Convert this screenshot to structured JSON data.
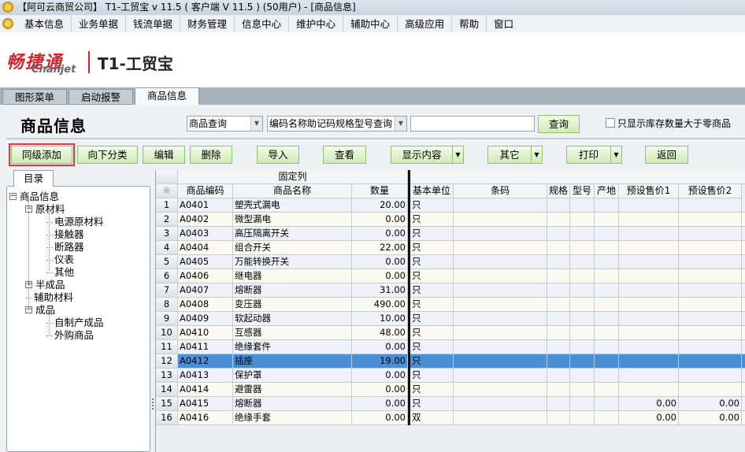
{
  "window": {
    "title": "【阿可云商贸公司】 T1-工贸宝 v 11.5 ( 客户端 V 11.5 ) (50用户) - [商品信息]"
  },
  "menu": [
    "基本信息",
    "业务单据",
    "钱流单据",
    "财务管理",
    "信息中心",
    "维护中心",
    "辅助中心",
    "高级应用",
    "帮助",
    "窗口"
  ],
  "logo": {
    "brand_cn": "畅捷通",
    "brand_en": "Chanjet",
    "product": "T1-工贸宝"
  },
  "tabs": [
    "图形菜单",
    "启动报警",
    "商品信息"
  ],
  "page": {
    "title": "商品信息"
  },
  "search": {
    "type": "商品查询",
    "mode": "编码名称助记码规格型号查询",
    "value": "",
    "query_label": "查询",
    "stock_checkbox_label": "只显示库存数量大于零商品",
    "stock_checked": false
  },
  "toolbar": {
    "same_level_add": "同级添加",
    "add_sub": "向下分类",
    "edit": "编辑",
    "delete": "删除",
    "import": "导入",
    "view": "查看",
    "display": "显示内容",
    "other": "其它",
    "print": "打印",
    "back": "返回"
  },
  "tree": {
    "tab": "目录",
    "nodes": [
      {
        "label": "商品信息",
        "level": 0,
        "toggle": "-"
      },
      {
        "label": "原材料",
        "level": 1,
        "toggle": "-"
      },
      {
        "label": "电源原材料",
        "level": 2
      },
      {
        "label": "接触器",
        "level": 2
      },
      {
        "label": "断路器",
        "level": 2
      },
      {
        "label": "仪表",
        "level": 2
      },
      {
        "label": "其他",
        "level": 2
      },
      {
        "label": "半成品",
        "level": 1,
        "toggle": "+"
      },
      {
        "label": "辅助材料",
        "level": 1
      },
      {
        "label": "成品",
        "level": 1,
        "toggle": "-"
      },
      {
        "label": "自制产成品",
        "level": 2
      },
      {
        "label": "外购商品",
        "level": 2
      }
    ]
  },
  "grid": {
    "fixed_group": "固定列",
    "corner": "※",
    "columns": [
      "商品编码",
      "商品名称",
      "数量",
      "基本单位",
      "条码",
      "规格",
      "型号",
      "产地",
      "预设售价1",
      "预设售价2"
    ],
    "selected_row": 12,
    "rows": [
      [
        "1",
        "A0401",
        "塑壳式漏电",
        "20.00",
        "只",
        "",
        "",
        "",
        "",
        "",
        ""
      ],
      [
        "2",
        "A0402",
        "微型漏电",
        "0.00",
        "只",
        "",
        "",
        "",
        "",
        "",
        ""
      ],
      [
        "3",
        "A0403",
        "高压隔离开关",
        "0.00",
        "只",
        "",
        "",
        "",
        "",
        "",
        ""
      ],
      [
        "4",
        "A0404",
        "组合开关",
        "22.00",
        "只",
        "",
        "",
        "",
        "",
        "",
        ""
      ],
      [
        "5",
        "A0405",
        "万能转换开关",
        "0.00",
        "只",
        "",
        "",
        "",
        "",
        "",
        ""
      ],
      [
        "6",
        "A0406",
        "继电器",
        "0.00",
        "只",
        "",
        "",
        "",
        "",
        "",
        ""
      ],
      [
        "7",
        "A0407",
        "熔断器",
        "31.00",
        "只",
        "",
        "",
        "",
        "",
        "",
        ""
      ],
      [
        "8",
        "A0408",
        "变压器",
        "490.00",
        "只",
        "",
        "",
        "",
        "",
        "",
        ""
      ],
      [
        "9",
        "A0409",
        "软起动器",
        "10.00",
        "只",
        "",
        "",
        "",
        "",
        "",
        ""
      ],
      [
        "10",
        "A0410",
        "互感器",
        "48.00",
        "只",
        "",
        "",
        "",
        "",
        "",
        ""
      ],
      [
        "11",
        "A0411",
        "绝缘套件",
        "0.00",
        "只",
        "",
        "",
        "",
        "",
        "",
        ""
      ],
      [
        "12",
        "A0412",
        "插座",
        "19.00",
        "只",
        "",
        "",
        "",
        "",
        "",
        ""
      ],
      [
        "13",
        "A0413",
        "保护罩",
        "0.00",
        "只",
        "",
        "",
        "",
        "",
        "",
        ""
      ],
      [
        "14",
        "A0414",
        "避雷器",
        "0.00",
        "只",
        "",
        "",
        "",
        "",
        "",
        ""
      ],
      [
        "15",
        "A0415",
        "熔断器",
        "0.00",
        "只",
        "",
        "",
        "",
        "",
        "0.00",
        "0.00"
      ],
      [
        "16",
        "A0416",
        "绝缘手套",
        "0.00",
        "双",
        "",
        "",
        "",
        "",
        "0.00",
        "0.00"
      ]
    ]
  }
}
